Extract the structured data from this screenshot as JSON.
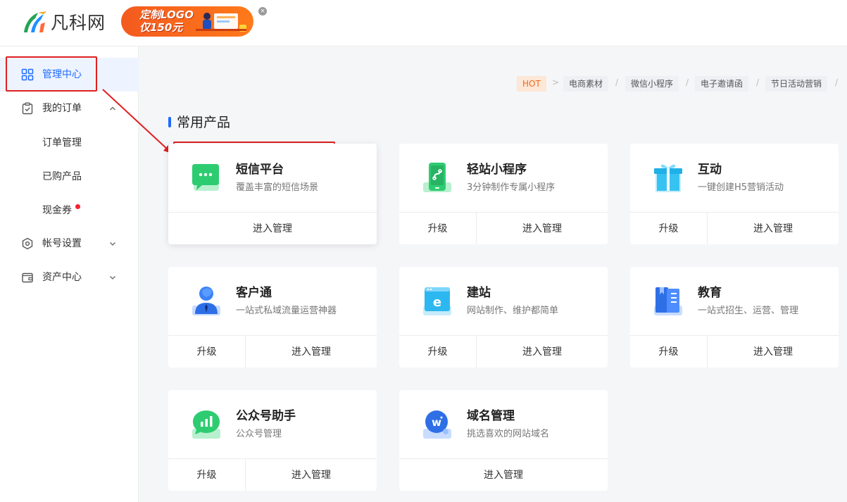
{
  "header": {
    "logo_text": "凡科网",
    "promo_line1": "定制LOGO",
    "promo_line2": "仅150元",
    "promo_close": "×"
  },
  "sidebar": {
    "items": [
      {
        "label": "管理中心",
        "icon": "grid-icon",
        "active": true
      },
      {
        "label": "我的订单",
        "icon": "clipboard-check-icon",
        "expanded": true
      },
      {
        "label": "帐号设置",
        "icon": "hexagon-settings-icon"
      },
      {
        "label": "资产中心",
        "icon": "wallet-icon"
      }
    ],
    "sub_items": [
      {
        "label": "订单管理"
      },
      {
        "label": "已购产品"
      },
      {
        "label": "现金券",
        "badge_dot": true
      }
    ]
  },
  "tags": [
    "HOT",
    "电商素材",
    "微信小程序",
    "电子邀请函",
    "节日活动营销"
  ],
  "tag_separators": [
    ">",
    "/",
    "/",
    "/",
    "/"
  ],
  "section_title": "常用产品",
  "cards": [
    {
      "title": "短信平台",
      "desc": "覆盖丰富的短信场景",
      "icon": "sms-chat-icon",
      "upgrade": "",
      "manage": "进入管理"
    },
    {
      "title": "轻站小程序",
      "desc": "3分钟制作专属小程序",
      "icon": "mini-program-phone-icon",
      "upgrade": "升级",
      "manage": "进入管理"
    },
    {
      "title": "互动",
      "desc": "一键创建H5营销活动",
      "icon": "gift-box-icon",
      "upgrade": "升级",
      "manage": "进入管理"
    },
    {
      "title": "客户通",
      "desc": "一站式私域流量运营神器",
      "icon": "customer-person-icon",
      "upgrade": "升级",
      "manage": "进入管理"
    },
    {
      "title": "建站",
      "desc": "网站制作、维护都简单",
      "icon": "website-e-icon",
      "upgrade": "升级",
      "manage": "进入管理"
    },
    {
      "title": "教育",
      "desc": "一站式招生、运营、管理",
      "icon": "education-book-icon",
      "upgrade": "升级",
      "manage": "进入管理"
    },
    {
      "title": "公众号助手",
      "desc": "公众号管理",
      "icon": "official-account-chart-icon",
      "upgrade": "升级",
      "manage": "进入管理"
    },
    {
      "title": "域名管理",
      "desc": "挑选喜欢的网站域名",
      "icon": "domain-globe-icon",
      "upgrade": "",
      "manage": "进入管理"
    }
  ],
  "colors": {
    "accent": "#1f6bff",
    "annotation_red": "#e02020",
    "hot_tag": "#ee6a20"
  }
}
